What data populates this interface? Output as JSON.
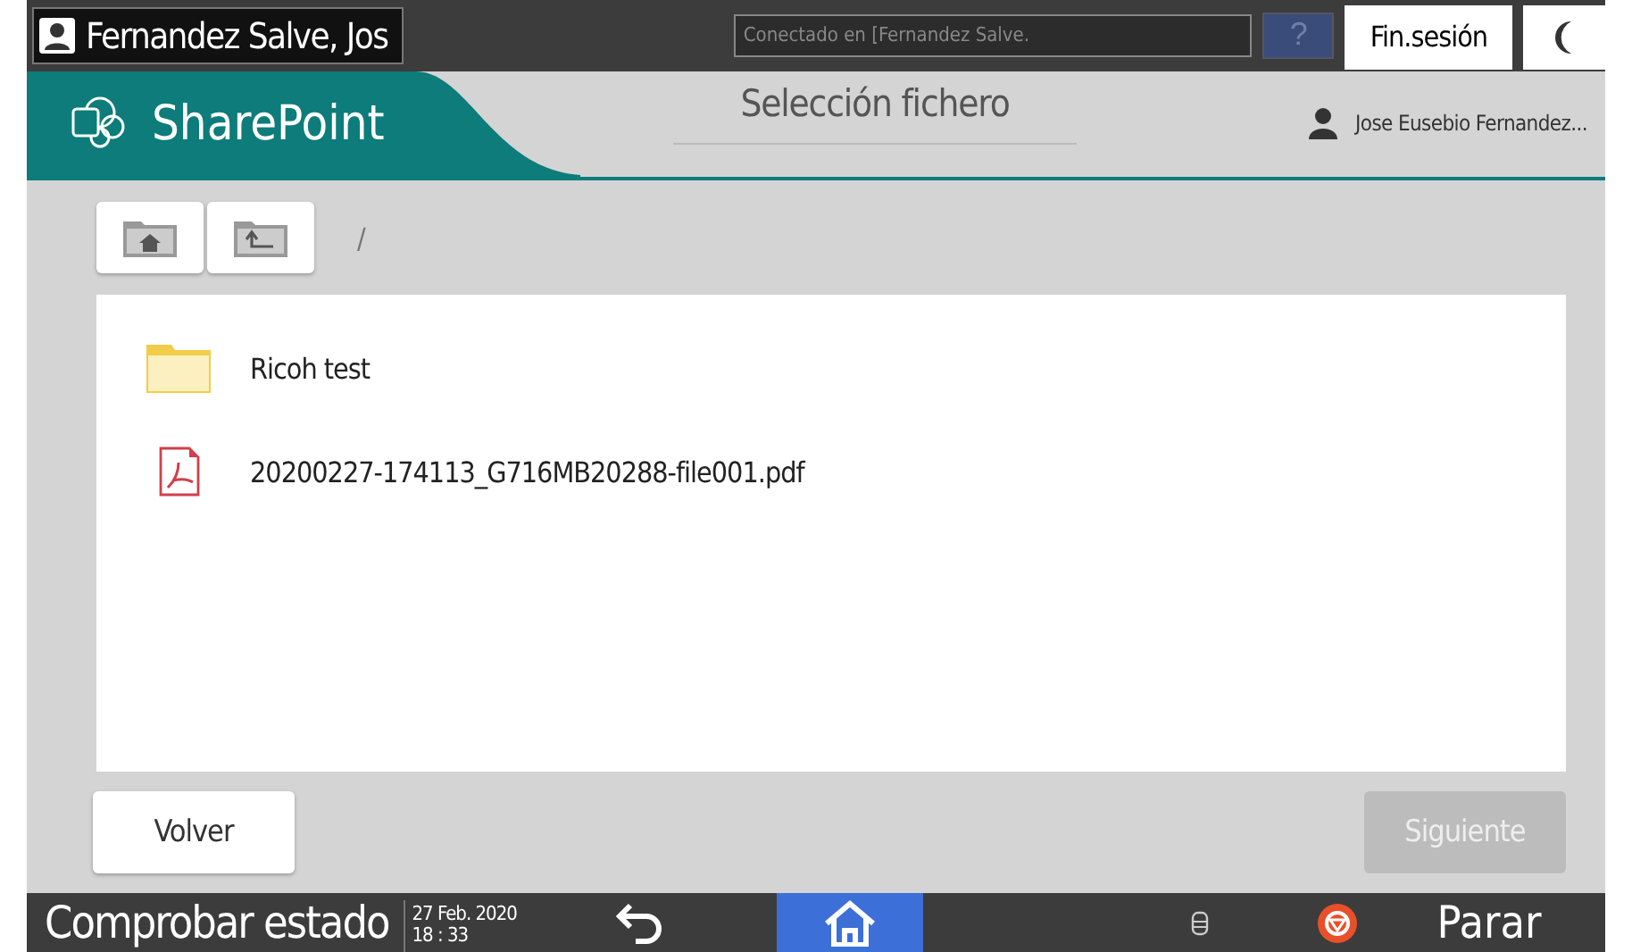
{
  "top_bar": {
    "user": "Fernandez Salve, Jos",
    "connection_placeholder": "Conectado en [Fernandez Salve.",
    "help": "?",
    "logout": "Fin.sesión"
  },
  "header": {
    "app": "SharePoint",
    "title": "Selección fichero",
    "account": "Jose Eusebio Fernandez..."
  },
  "path": "/",
  "files": [
    {
      "kind": "folder",
      "name": "Ricoh test"
    },
    {
      "kind": "pdf",
      "name": "20200227-174113_G716MB20288-file001.pdf"
    }
  ],
  "buttons": [
    {
      "label": "Volver",
      "disabled": false
    },
    {
      "label": "Siguiente",
      "disabled": true
    }
  ],
  "status_bar": {
    "status": "Comprobar estado",
    "date": "27 Feb. 2020",
    "time": "18 : 33",
    "stop": "Parar"
  }
}
